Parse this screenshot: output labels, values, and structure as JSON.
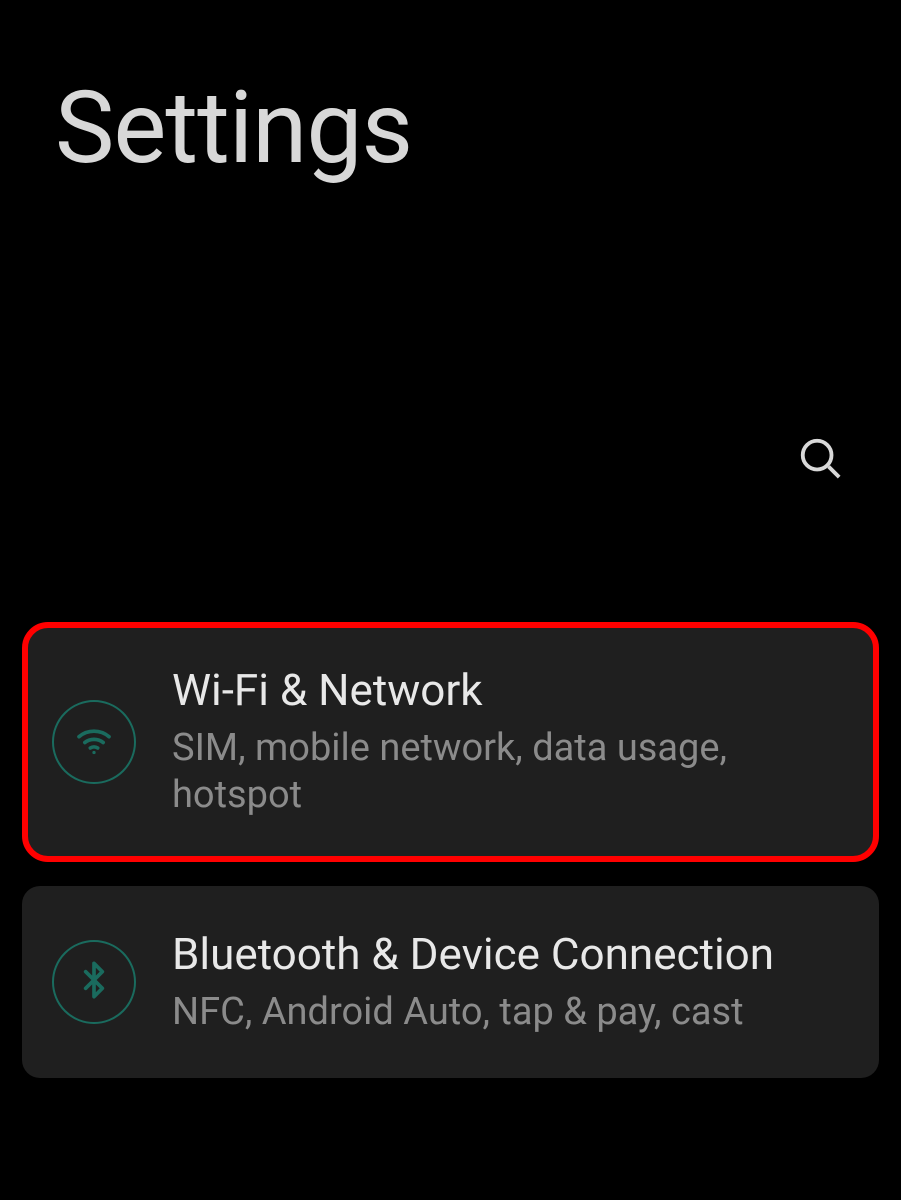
{
  "header": {
    "title": "Settings"
  },
  "items": [
    {
      "title": "Wi-Fi & Network",
      "subtitle": "SIM, mobile network, data usage, hotspot",
      "icon": "wifi-icon",
      "highlighted": true
    },
    {
      "title": "Bluetooth & Device Connection",
      "subtitle": "NFC, Android Auto, tap & pay, cast",
      "icon": "bluetooth-icon",
      "highlighted": false
    }
  ],
  "colors": {
    "accent": "#1a6b5e",
    "highlight": "#ff0000",
    "cardBg": "#1f1f1f",
    "textPrimary": "#e8e8e8",
    "textSecondary": "#8b8b8b"
  }
}
